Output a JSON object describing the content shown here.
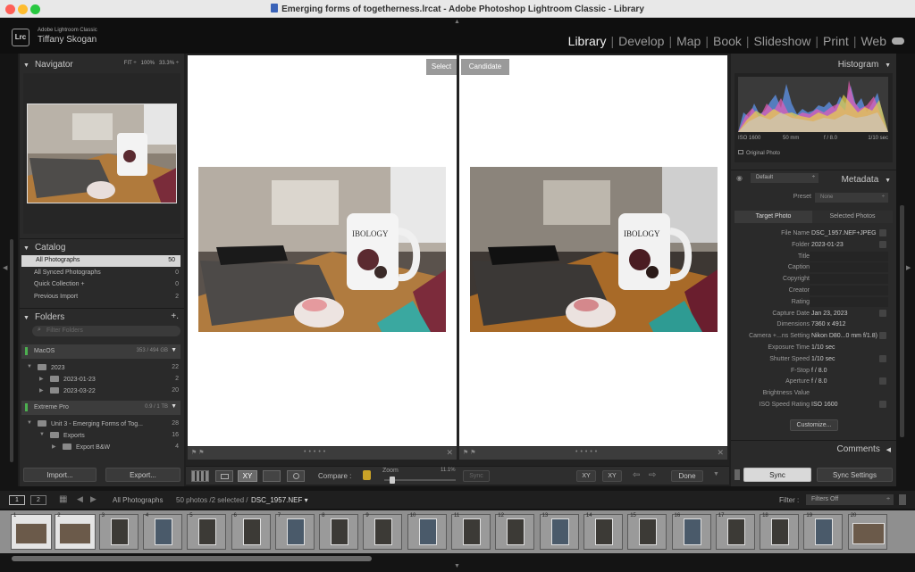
{
  "window": {
    "title": "Emerging forms of togetherness.lrcat - Adobe Photoshop Lightroom Classic - Library"
  },
  "identity": {
    "app_name": "Adobe Lightroom Classic",
    "user": "Tiffany Skogan",
    "logo": "Lrc"
  },
  "modules": [
    "Library",
    "Develop",
    "Map",
    "Book",
    "Slideshow",
    "Print",
    "Web"
  ],
  "active_module": "Library",
  "navigator": {
    "title": "Navigator",
    "zoom_fit": "FIT",
    "zoom_100": "100%",
    "zoom_33": "33.3%"
  },
  "catalog": {
    "title": "Catalog",
    "items": [
      {
        "label": "All Photographs",
        "count": "50"
      },
      {
        "label": "All Synced Photographs",
        "count": "0"
      },
      {
        "label": "Quick Collection +",
        "count": "0"
      },
      {
        "label": "Previous Import",
        "count": "2"
      }
    ]
  },
  "folders": {
    "title": "Folders",
    "add": "+.",
    "filter_placeholder": "Filter Folders",
    "volumes": [
      {
        "name": "MacOS",
        "space": "353 / 494 GB"
      },
      {
        "name": "Extreme Pro",
        "space": "0.9 / 1 TB"
      }
    ],
    "items": [
      {
        "label": "2023",
        "count": "22"
      },
      {
        "label": "2023-01-23",
        "count": "2"
      },
      {
        "label": "2023-03-22",
        "count": "20"
      },
      {
        "label": "Unit 3 - Emerging Forms of Tog...",
        "count": "28"
      },
      {
        "label": "Exports",
        "count": "16"
      },
      {
        "label": "Export B&W",
        "count": "4"
      }
    ]
  },
  "left_buttons": {
    "import": "Import...",
    "export": "Export..."
  },
  "compare": {
    "select_label": "Select",
    "candidate_label": "Candidate",
    "toolbar_label": "Compare :",
    "zoom_label": "Zoom",
    "zoom_value": "11.1%",
    "zoom_level": 0.08,
    "sync": "Sync",
    "done": "Done"
  },
  "histogram": {
    "title": "Histogram",
    "iso": "ISO 1600",
    "focal": "50 mm",
    "aperture": "f / 8.0",
    "shutter": "1/10 sec",
    "original": "Original Photo"
  },
  "metadata": {
    "title": "Metadata",
    "preset_set": "Default",
    "preset_label": "Preset",
    "preset_value": "None",
    "tab_target": "Target Photo",
    "tab_selected": "Selected Photos",
    "fields": [
      {
        "k": "File Name",
        "v": "DSC_1957.NEF+JPEG"
      },
      {
        "k": "Folder",
        "v": "2023-01-23"
      },
      {
        "k": "Title",
        "v": ""
      },
      {
        "k": "Caption",
        "v": ""
      },
      {
        "k": "Copyright",
        "v": ""
      },
      {
        "k": "Creator",
        "v": ""
      },
      {
        "k": "Rating",
        "v": ""
      },
      {
        "k": "Capture Date",
        "v": "Jan 23, 2023"
      },
      {
        "k": "Dimensions",
        "v": "7360 x 4912"
      },
      {
        "k": "Camera +...ns Setting",
        "v": "Nikon D80...0 mm f/1.8)"
      },
      {
        "k": "Exposure Time",
        "v": "1/10 sec"
      },
      {
        "k": "Shutter Speed",
        "v": "1/10 sec"
      },
      {
        "k": "F-Stop",
        "v": "f / 8.0"
      },
      {
        "k": "Aperture",
        "v": "f / 8.0"
      },
      {
        "k": "Brightness Value",
        "v": ""
      },
      {
        "k": "ISO Speed Rating",
        "v": "ISO 1600"
      }
    ],
    "customize": "Customize..."
  },
  "comments": {
    "title": "Comments"
  },
  "right_buttons": {
    "sync": "Sync",
    "sync_settings": "Sync Settings"
  },
  "filmstrip": {
    "page1": "1",
    "page2": "2",
    "source": "All Photographs",
    "info": "50 photos /2 selected /",
    "file": "DSC_1957.NEF",
    "filter_label": "Filter :",
    "filter_value": "Filters Off",
    "thumbs": [
      "1",
      "2",
      "3",
      "4",
      "5",
      "6",
      "7",
      "8",
      "9",
      "10",
      "11",
      "12",
      "13",
      "14",
      "15",
      "16",
      "17",
      "18",
      "19",
      "20"
    ]
  },
  "colors": {
    "accent_select": "#6a6a6a",
    "sync_button": "#d9d9d9"
  }
}
